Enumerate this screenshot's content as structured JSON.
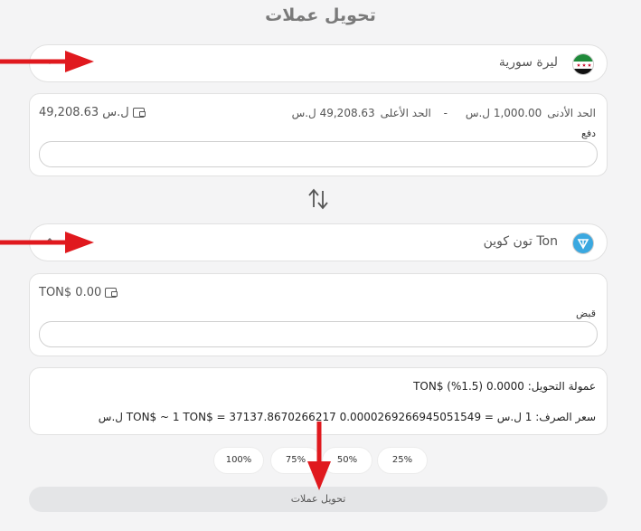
{
  "page_title": "تحويل عملات",
  "from": {
    "currency_name": "ليرة سورية",
    "min_label": "الحد الأدنى",
    "min_value": "1,000.00 ل.س",
    "separator": "-",
    "max_label": "الحد الأعلى",
    "max_value": "49,208.63 ل.س",
    "balance": "49,208.63 ل.س",
    "field_label": "دفع",
    "input_value": ""
  },
  "to": {
    "currency_name": "Ton تون كوين",
    "balance": "TON$ 0.00",
    "field_label": "قبض",
    "input_value": ""
  },
  "info": {
    "fee_line": "عمولة التحويل: 0.0000 TON$ (%1.5)",
    "rate_line": "سعر الصرف: 1 ل.س = 0.0000269266945051549 TON$ ~ 1 TON$ = 37137.8670266217 ل.س"
  },
  "percent_buttons": [
    "100%",
    "75%",
    "50%",
    "25%"
  ],
  "submit_label": "تحويل عملات",
  "colors": {
    "background": "#f4f4f5",
    "card": "#ffffff",
    "annotation_arrow": "#e0191e",
    "ton_blue": "#3aa8e0",
    "flag_green": "#1f8a3a"
  },
  "icons": [
    "syria-flag-icon",
    "ton-logo-icon",
    "wallet-icon",
    "chevron-icon",
    "swap-icon"
  ]
}
